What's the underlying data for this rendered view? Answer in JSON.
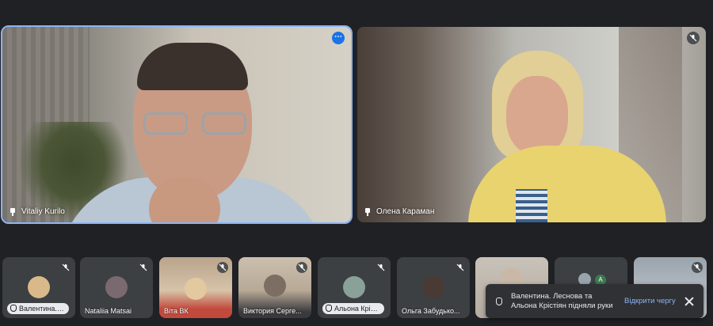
{
  "main_tiles": [
    {
      "name": "Vitaliy Kurilo",
      "active": true
    },
    {
      "name": "Олена Караман",
      "active": false
    }
  ],
  "thumbnails": [
    {
      "label": "Валентина. Лесн...",
      "hand_raised": true,
      "avatar_color": "#d9b98a"
    },
    {
      "label": "Nataliia Matsai",
      "hand_raised": false,
      "avatar_color": "#7a6a70"
    },
    {
      "label": "Віта ВК",
      "hand_raised": false,
      "avatar_color": "#e3c9a0"
    },
    {
      "label": "Виктория Серге...",
      "hand_raised": false,
      "avatar_color": "#7d6e63"
    },
    {
      "label": "Альона Крістіян",
      "hand_raised": true,
      "avatar_color": "#8aa19a"
    },
    {
      "label": "Ольга Забудько...",
      "hand_raised": false,
      "avatar_color": "#4a3a34"
    },
    {
      "label": "",
      "hand_raised": false,
      "avatar_color": "#c9b8a6"
    },
    {
      "label": "",
      "hand_raised": false,
      "avatar_color": "#3c7a52"
    },
    {
      "label": "",
      "hand_raised": false,
      "avatar_color": "#9aa4ad"
    }
  ],
  "toast": {
    "message": "Валентина. Леснова та Альона Крістіян підняли руки",
    "action": "Відкрити чергу"
  },
  "extra_avatar_letter": "A",
  "icons": {
    "pin": "pin-icon",
    "mic_off": "mic-off-icon",
    "more": "more-options-icon",
    "hand": "raised-hand-icon",
    "close": "close-icon"
  }
}
